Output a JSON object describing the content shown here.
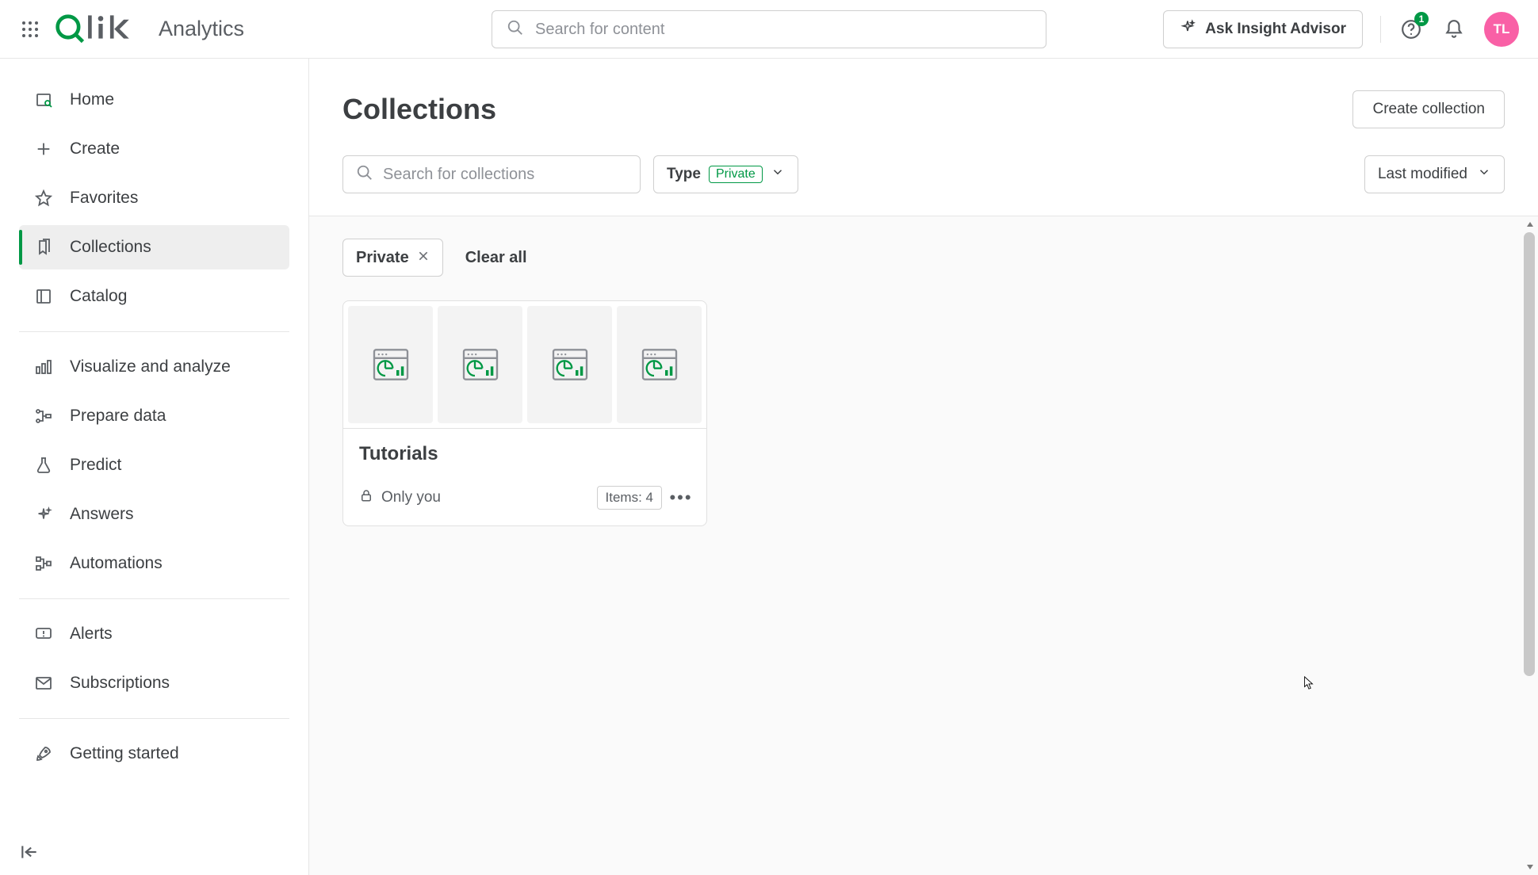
{
  "topbar": {
    "product_label": "Analytics",
    "search_placeholder": "Search for content",
    "ask_label": "Ask Insight Advisor",
    "help_badge": "1",
    "avatar_initials": "TL"
  },
  "sidebar": {
    "items": [
      {
        "label": "Home"
      },
      {
        "label": "Create"
      },
      {
        "label": "Favorites"
      },
      {
        "label": "Collections"
      },
      {
        "label": "Catalog"
      },
      {
        "label": "Visualize and analyze"
      },
      {
        "label": "Prepare data"
      },
      {
        "label": "Predict"
      },
      {
        "label": "Answers"
      },
      {
        "label": "Automations"
      },
      {
        "label": "Alerts"
      },
      {
        "label": "Subscriptions"
      },
      {
        "label": "Getting started"
      }
    ]
  },
  "page": {
    "title": "Collections",
    "create_btn": "Create collection",
    "search_placeholder": "Search for collections",
    "type_label": "Type",
    "type_value": "Private",
    "sort_label": "Last modified",
    "chip_label": "Private",
    "clear_all": "Clear all"
  },
  "collections": [
    {
      "title": "Tutorials",
      "visibility": "Only you",
      "items_label": "Items: 4"
    }
  ]
}
